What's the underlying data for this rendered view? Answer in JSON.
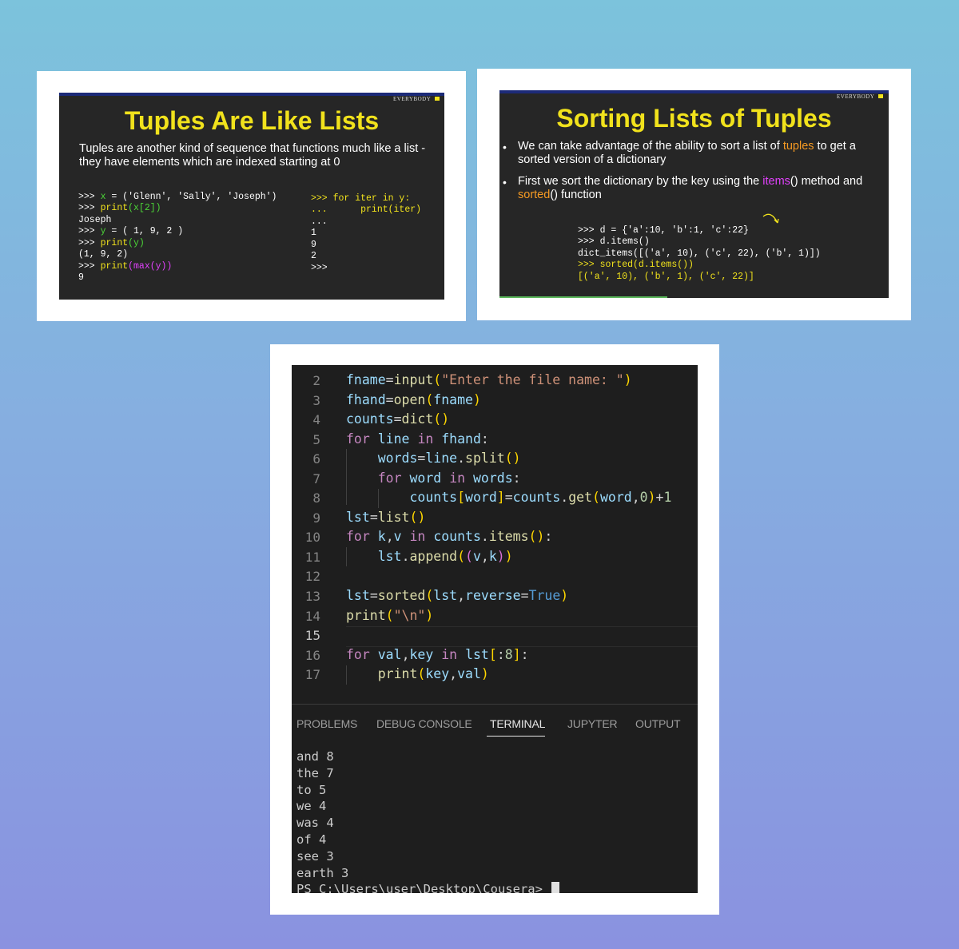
{
  "slide1": {
    "brand": "EVERYBODY",
    "title": "Tuples Are Like Lists",
    "description": "Tuples are another kind of sequence that functions much like a list - they have elements which are indexed starting at 0",
    "left_code": [
      {
        "prompt": ">>> ",
        "var": "x",
        "rest": " = ('Glenn', 'Sally', 'Joseph')"
      },
      {
        "prompt": ">>> ",
        "fn": "print",
        "arg": "(x[2])"
      },
      {
        "output": "Joseph"
      },
      {
        "prompt": ">>> ",
        "var": "y",
        "rest": " = ( 1, 9, 2 )"
      },
      {
        "prompt": ">>> ",
        "fn": "print",
        "arg": "(y)"
      },
      {
        "output": "(1, 9, 2)"
      },
      {
        "prompt": ">>> ",
        "fn": "print",
        "arg2": "(max(y))"
      },
      {
        "output": "9"
      }
    ],
    "right_code": [
      ">>> for iter in y:",
      "...      print(iter)",
      "...",
      "1",
      "9",
      "2",
      ">>>"
    ]
  },
  "slide2": {
    "brand": "EVERYBODY",
    "title": "Sorting Lists of Tuples",
    "bullet1_a": "We can take advantage of the ability to sort a list of ",
    "bullet1_hl": "tuples",
    "bullet1_b": " to get a sorted version of a dictionary",
    "bullet2_a": "First we sort the dictionary by the key using the ",
    "bullet2_hl": "items",
    "bullet2_b": "() method and ",
    "bullet2_hl2": "sorted",
    "bullet2_c": "() function",
    "code": [
      ">>> d = {'a':10, 'b':1, 'c':22}",
      ">>> d.items()",
      "dict_items([('a', 10), ('c', 22), ('b', 1)])",
      ">>> sorted(d.items())",
      "[('a', 10), ('b', 1), ('c', 22)]"
    ]
  },
  "editor": {
    "line_numbers": [
      "2",
      "3",
      "4",
      "5",
      "6",
      "7",
      "8",
      "9",
      "10",
      "11",
      "12",
      "13",
      "14",
      "15",
      "16",
      "17"
    ],
    "current_line": "15",
    "code_lines": [
      "fname=input(\"Enter the file name: \")",
      "fhand=open(fname)",
      "counts=dict()",
      "for line in fhand:",
      "    words=line.split()",
      "    for word in words:",
      "        counts[word]=counts.get(word,0)+1",
      "lst=list()",
      "for k,v in counts.items():",
      "    lst.append((v,k))",
      "",
      "lst=sorted(lst,reverse=True)",
      "print(\"\\n\")",
      "",
      "for val,key in lst[:8]:",
      "    print(key,val)"
    ]
  },
  "panel": {
    "tabs": [
      "PROBLEMS",
      "DEBUG CONSOLE",
      "TERMINAL",
      "JUPYTER",
      "OUTPUT"
    ],
    "active_tab": "TERMINAL",
    "terminal_lines": [
      "and 8",
      "the 7",
      "to 5",
      "we 4",
      "was 4",
      "of 4",
      "see 3",
      "earth 3"
    ],
    "prompt": "PS C:\\Users\\user\\Desktop\\Cousera> "
  }
}
